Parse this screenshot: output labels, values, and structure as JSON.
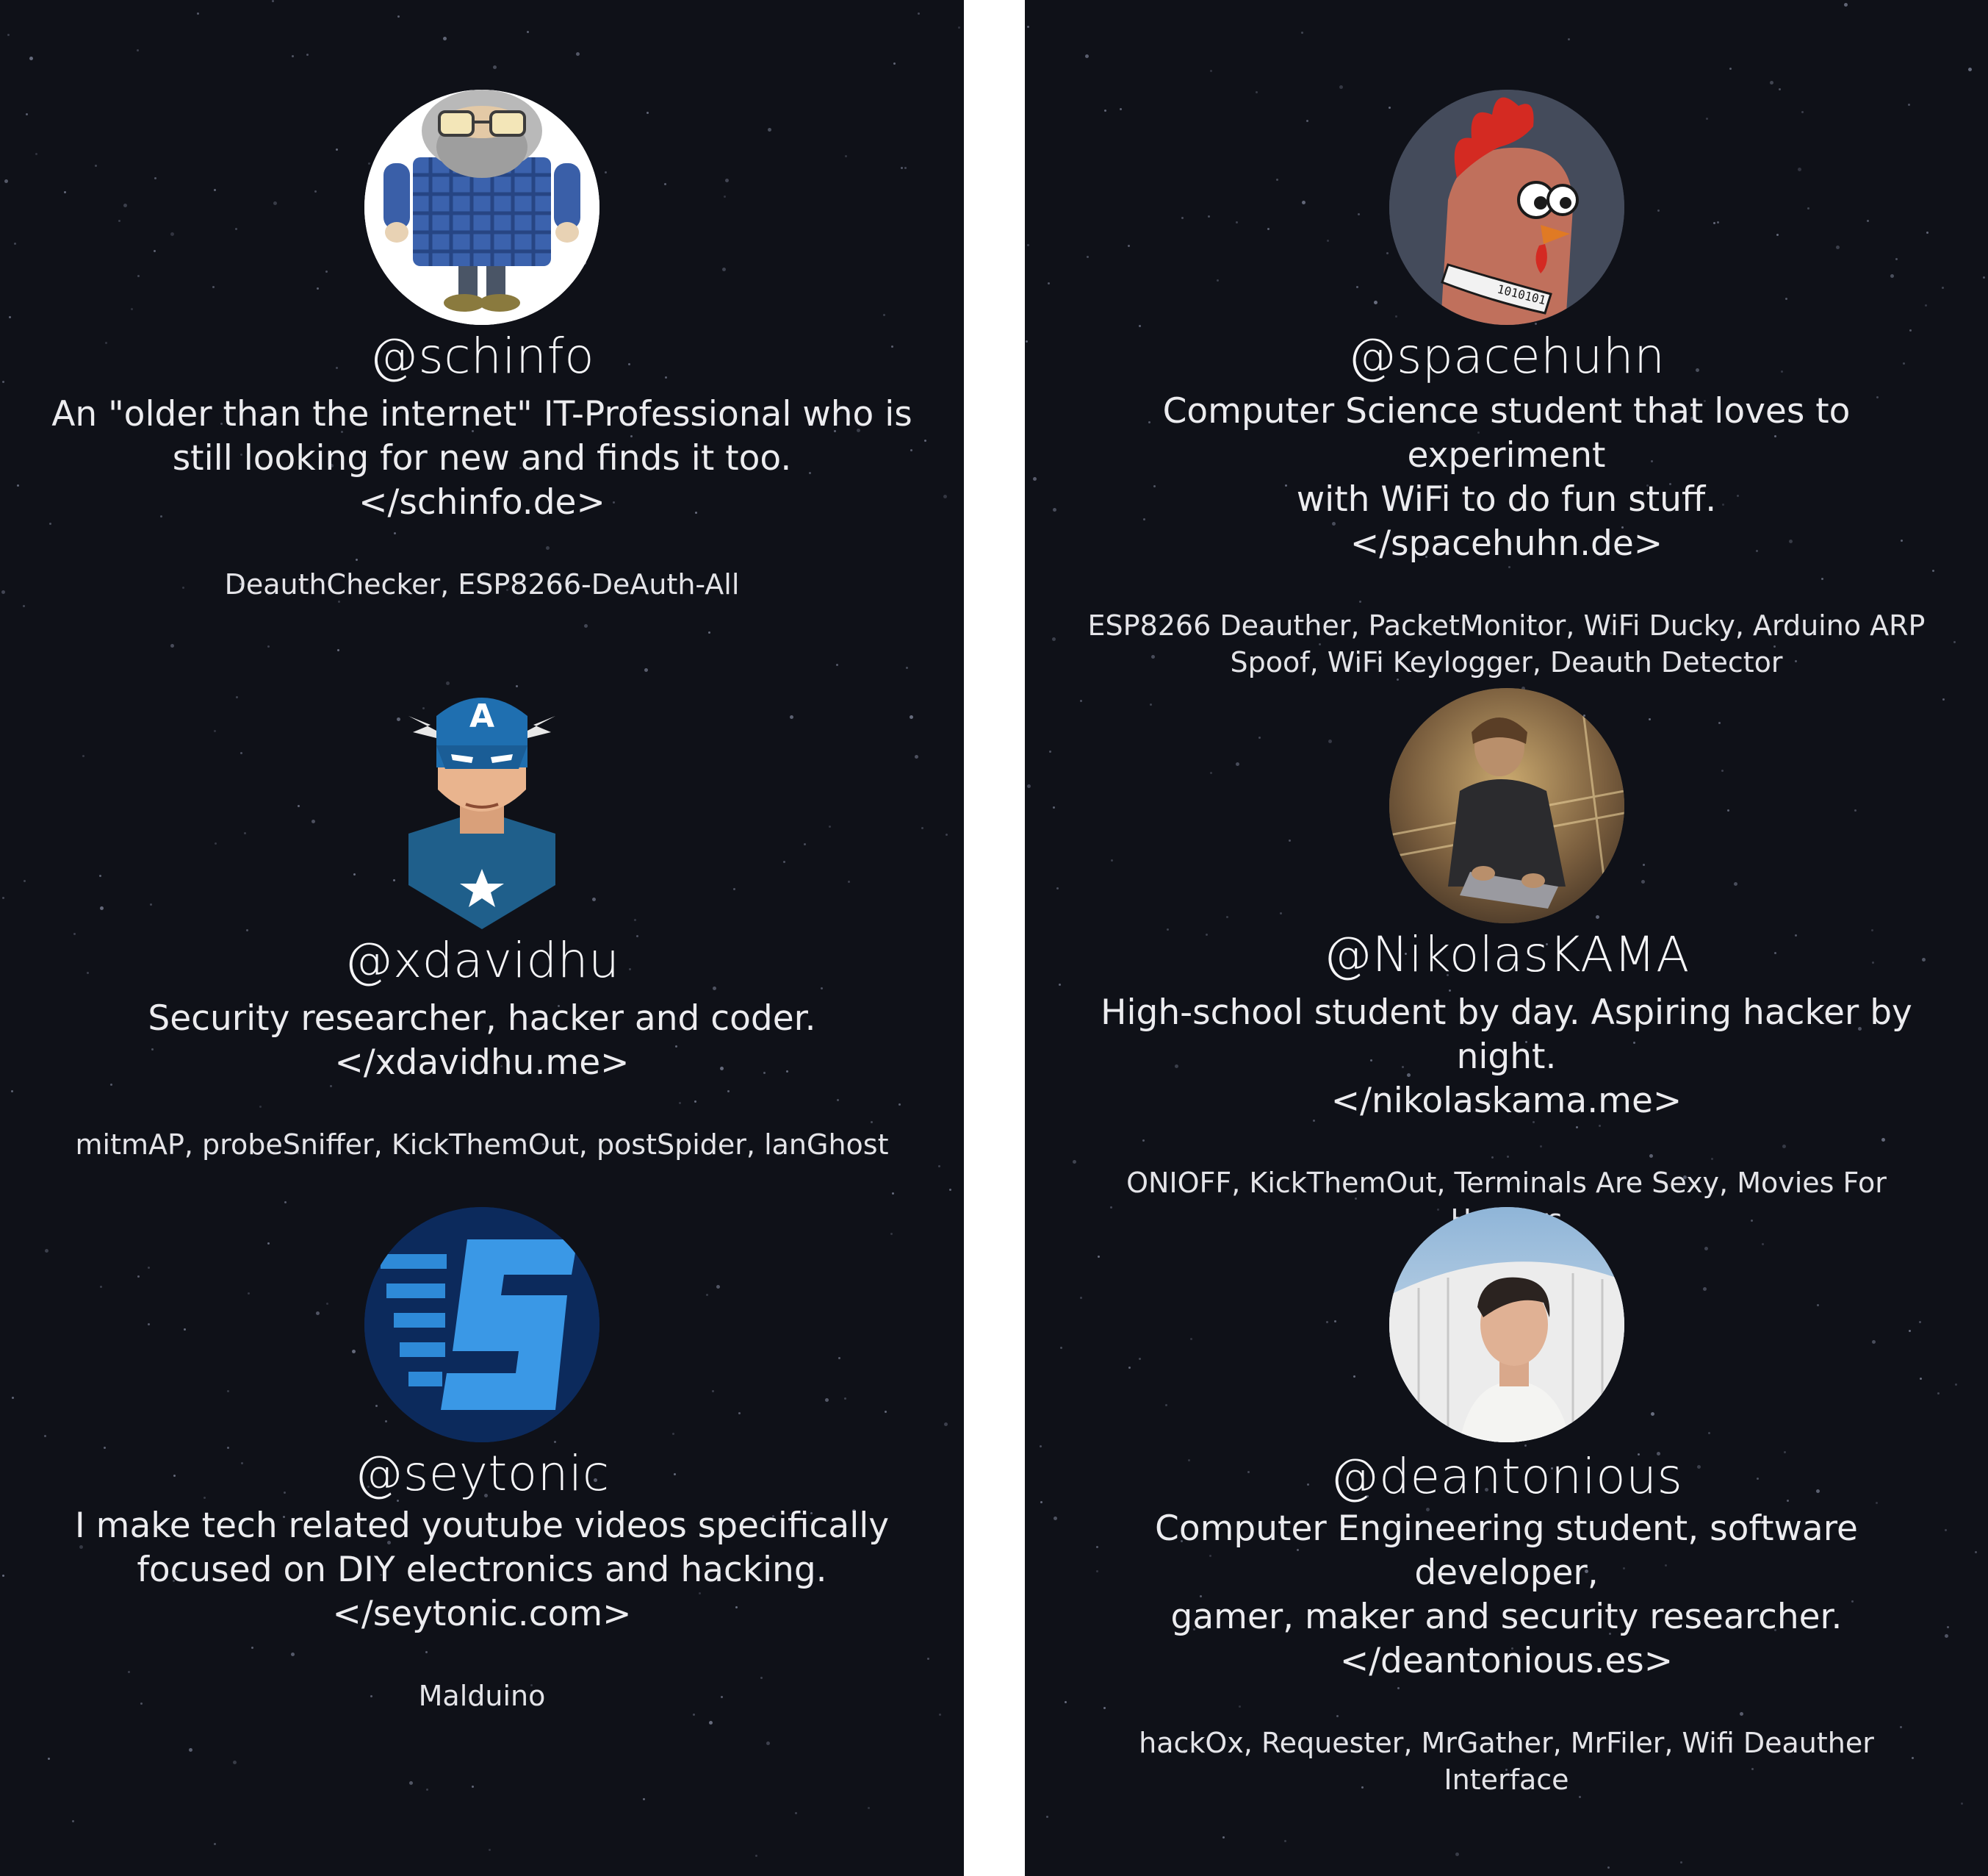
{
  "colors": {
    "panel_background": "#0f1118",
    "divider": "#ffffff",
    "text": "#f3f3f5"
  },
  "left_column": [
    {
      "handle": "@schinfo",
      "bio": "An \"older than the internet\" IT-Professional who is\nstill looking for new and finds it too.",
      "website": "</schinfo.de>",
      "projects": "DeauthChecker, ESP8266-DeAuth-All",
      "avatar_icon": "bearded-man-plaid-shirt-avatar"
    },
    {
      "handle": "@xdavidhu",
      "bio": "Security researcher, hacker and coder.",
      "website": "</xdavidhu.me>",
      "projects": "mitmAP, probeSniffer, KickThemOut, postSpider, lanGhost",
      "avatar_icon": "captain-america-avatar"
    },
    {
      "handle": "@seytonic",
      "bio": "I make tech related youtube videos specifically\nfocused on DIY electronics and hacking.",
      "website": "</seytonic.com>",
      "projects": "Malduino",
      "avatar_icon": "seytonic-s-logo-avatar"
    }
  ],
  "right_column": [
    {
      "handle": "@spacehuhn",
      "bio": "Computer Science student that loves to experiment\nwith WiFi to do fun stuff.",
      "website": "</spacehuhn.de>",
      "projects": "ESP8266 Deauther, PacketMonitor, WiFi Ducky, Arduino ARP\nSpoof, WiFi Keylogger, Deauth Detector",
      "avatar_icon": "chicken-avatar"
    },
    {
      "handle": "@NikolasKAMA",
      "bio": "High-school student by day. Aspiring hacker by night.",
      "website": "</nikolaskama.me>",
      "projects": "ONIOFF, KickThemOut, Terminals Are Sexy, Movies For Hackers",
      "avatar_icon": "photo-boy-with-laptop-avatar"
    },
    {
      "handle": "@deantonious",
      "bio": "Computer Engineering student, software developer,\ngamer, maker and security researcher.",
      "website": "</deantonious.es>",
      "projects": "hackOx, Requester, MrGather, MrFiler, Wifi Deauther Interface",
      "avatar_icon": "photo-young-man-avatar"
    }
  ]
}
